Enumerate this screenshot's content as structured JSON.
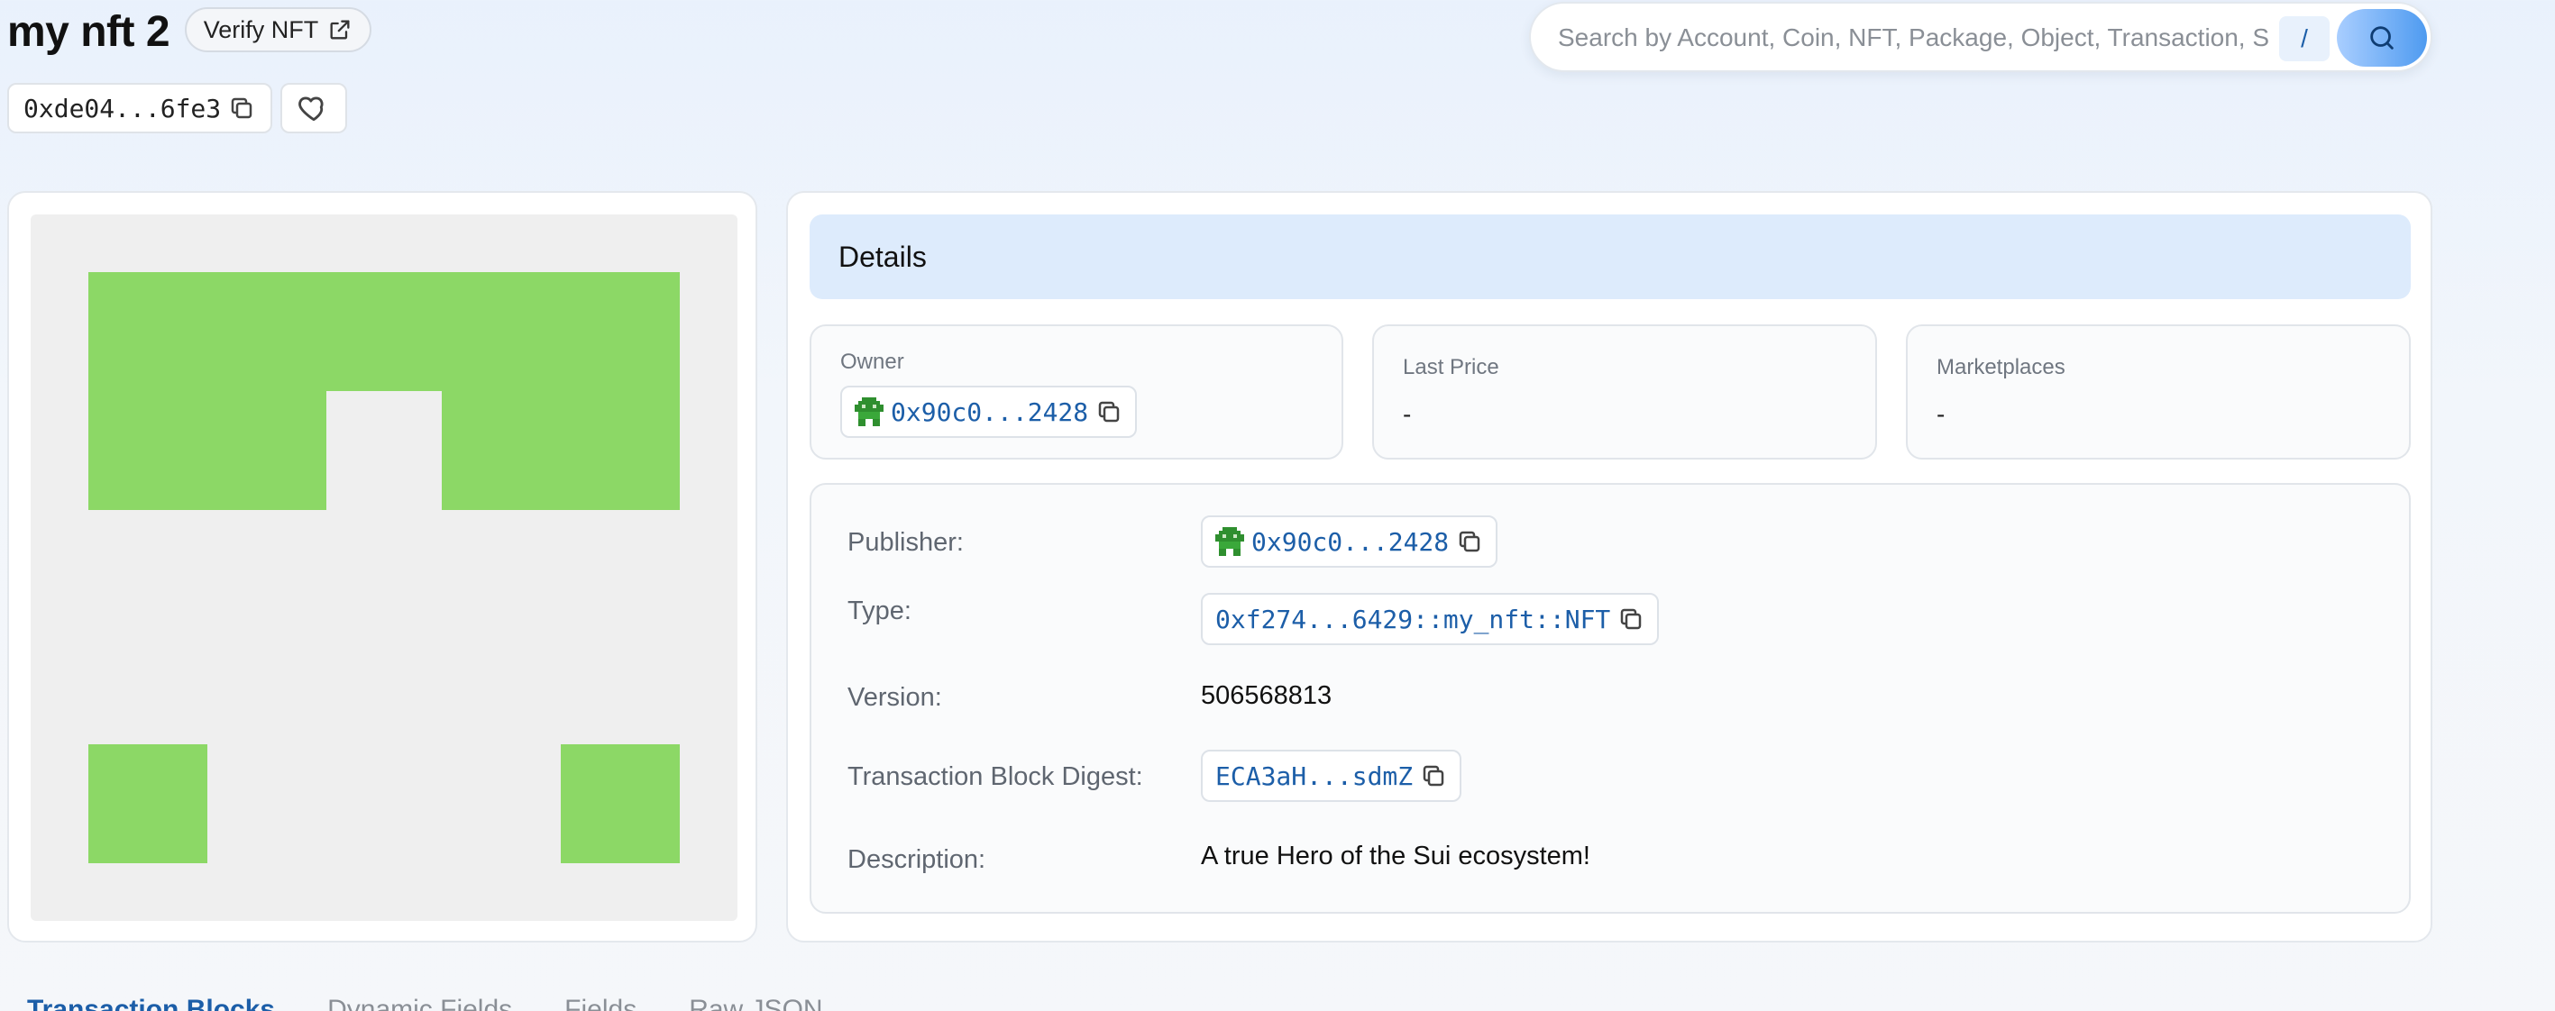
{
  "header": {
    "title": "my nft 2",
    "verify_label": "Verify NFT",
    "object_address": "0xde04...6fe3"
  },
  "search": {
    "placeholder": "Search by Account, Coin, NFT, Package, Object, Transaction, S...",
    "shortcut": "/"
  },
  "image": {
    "background_color": "#efefef",
    "pixel_color": "#8cd866"
  },
  "details": {
    "heading": "Details",
    "owner_label": "Owner",
    "owner_value": "0x90c0...2428",
    "last_price_label": "Last Price",
    "last_price_value": "-",
    "marketplaces_label": "Marketplaces",
    "marketplaces_value": "-",
    "rows": {
      "publisher_label": "Publisher:",
      "publisher_value": "0x90c0...2428",
      "type_label": "Type:",
      "type_value": "0xf274...6429::my_nft::NFT",
      "version_label": "Version:",
      "version_value": "506568813",
      "digest_label": "Transaction Block Digest:",
      "digest_value": "ECA3aH...sdmZ",
      "description_label": "Description:",
      "description_value": "A true Hero of the Sui ecosystem!"
    }
  },
  "tabs": [
    {
      "label": "Transaction Blocks",
      "active": true
    },
    {
      "label": "Dynamic Fields",
      "active": false
    },
    {
      "label": "Fields",
      "active": false
    },
    {
      "label": "Raw JSON",
      "active": false
    }
  ],
  "colors": {
    "accent": "#1c5ea8",
    "details_header_bg": "#ddebfc",
    "search_button_gradient_end": "#4f9bf0"
  }
}
